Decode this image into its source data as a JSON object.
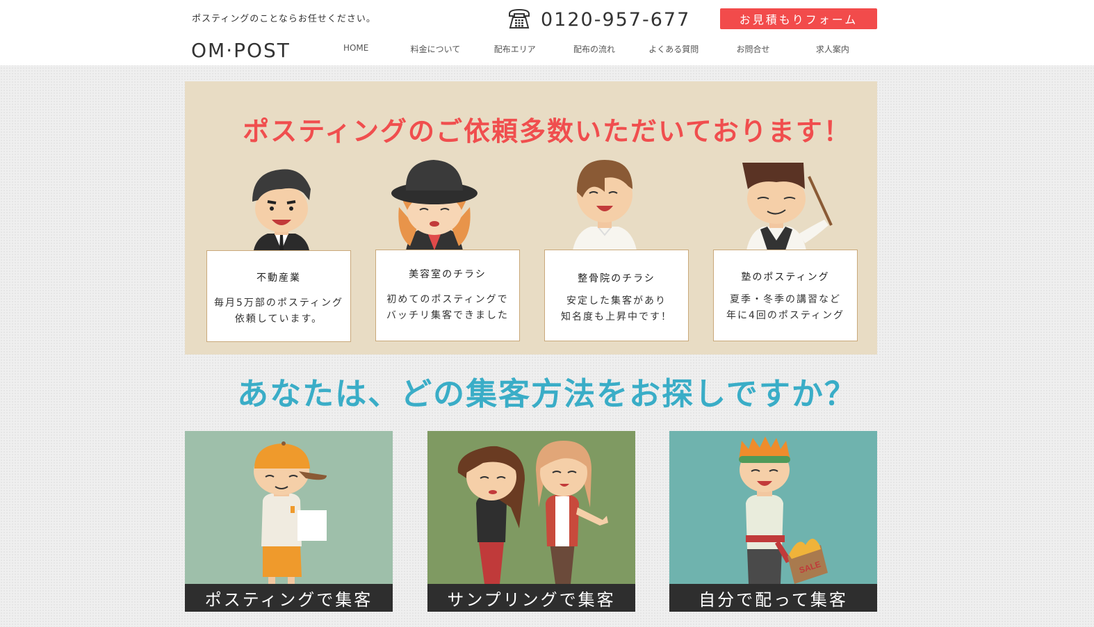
{
  "header": {
    "tagline": "ポスティングのことならお任せください。",
    "logo": "OM·POST",
    "phone": "0120-957-677",
    "quote_button": "お見積もりフォーム",
    "nav": [
      "HOME",
      "料金について",
      "配布エリア",
      "配布の流れ",
      "よくある質問",
      "お問合せ",
      "求人案内"
    ]
  },
  "hero": {
    "title": "ポスティングのご依頼多数いただいております！",
    "cards": [
      {
        "title": "不動産業",
        "text": "毎月5万部のポスティング\n依頼しています。"
      },
      {
        "title": "美容室のチラシ",
        "text": "初めてのポスティングで\nバッチリ集客できました"
      },
      {
        "title": "整骨院のチラシ",
        "text": "安定した集客があり\n知名度も上昇中です！"
      },
      {
        "title": "塾のポスティング",
        "text": "夏季・冬季の講習など\n年に4回のポスティング"
      }
    ]
  },
  "section": {
    "title": "あなたは、どの集客方法をお探しですか？"
  },
  "panels": [
    {
      "label": "ポスティングで集客",
      "bg": "#9ebfaa"
    },
    {
      "label": "サンプリングで集客",
      "bg": "#7f9a62"
    },
    {
      "label": "自分で配って集客",
      "bg": "#6fb3ae"
    }
  ],
  "colors": {
    "accent_red": "#f24b4b",
    "accent_blue": "#3aadc7",
    "hero_bg": "#e8dcc4"
  },
  "icons": [
    "telephone-icon"
  ]
}
